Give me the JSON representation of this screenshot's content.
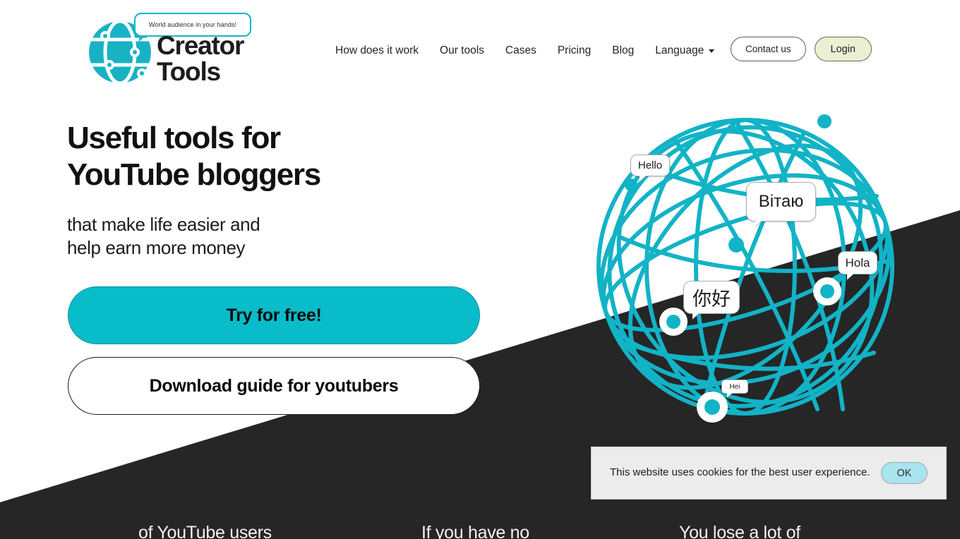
{
  "brand": {
    "tagline": "World audience in your hands!",
    "name_line1": "Creator",
    "name_line2": "Tools",
    "globe_icon": "globe-icon"
  },
  "nav": {
    "items": [
      {
        "label": "How does it work"
      },
      {
        "label": "Our tools"
      },
      {
        "label": "Cases"
      },
      {
        "label": "Pricing"
      },
      {
        "label": "Blog"
      },
      {
        "label": "Language"
      }
    ],
    "language_caret": "chevron-down-icon",
    "contact_label": "Contact us",
    "login_label": "Login"
  },
  "hero": {
    "title_line1": "Useful tools for",
    "title_line2": "YouTube bloggers",
    "subtitle_line1": "that make life easier and",
    "subtitle_line2": "help earn more money",
    "cta_primary": "Try for free!",
    "cta_secondary": "Download guide for youtubers"
  },
  "illustration": {
    "name": "globe-network-illustration",
    "bubbles": [
      {
        "id": "hello",
        "text": "Hello"
      },
      {
        "id": "vitayu",
        "text": "Вітаю"
      },
      {
        "id": "hola",
        "text": "Hola"
      },
      {
        "id": "nihao",
        "text": "你好"
      },
      {
        "id": "hei",
        "text": "Hei"
      }
    ]
  },
  "cookie_banner": {
    "message": "This website uses cookies for the best user experience.",
    "accept_label": "OK"
  },
  "bottom_section": {
    "columns": [
      {
        "text": "of YouTube users"
      },
      {
        "text": "If you have no"
      },
      {
        "text": "You lose a lot of"
      }
    ]
  },
  "colors": {
    "teal": "#09bcc9",
    "logo_teal": "#19b5c7",
    "dark": "#262626",
    "login_bg": "#ecefd2",
    "cookie_bg": "#ececec",
    "ok_bg": "#a9e4ef"
  }
}
